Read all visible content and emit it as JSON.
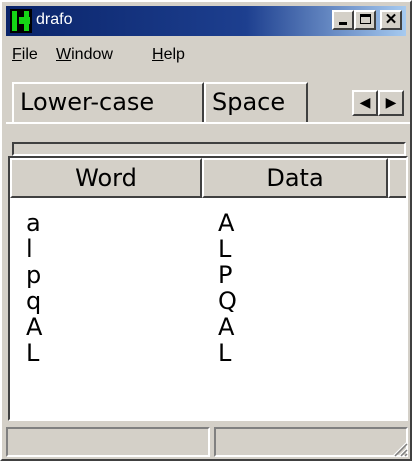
{
  "window": {
    "title": "drafo"
  },
  "menu": {
    "items": [
      "File",
      "Window",
      "Help"
    ]
  },
  "tabs": [
    {
      "label": "Lower-case"
    },
    {
      "label": "Space"
    }
  ],
  "table": {
    "columns": [
      "Word",
      "Data"
    ],
    "rows": [
      {
        "word": "a",
        "data": "A"
      },
      {
        "word": "l",
        "data": "L"
      },
      {
        "word": "p",
        "data": "P"
      },
      {
        "word": "q",
        "data": "Q"
      },
      {
        "word": "A",
        "data": "A"
      },
      {
        "word": "L",
        "data": "L"
      }
    ]
  },
  "statusbar": {
    "panes": [
      "",
      ""
    ]
  },
  "colors": {
    "face": "#d4d0c8",
    "titlebar_start": "#0a246a",
    "titlebar_end": "#a6caf0",
    "icon_green": "#15d615"
  }
}
